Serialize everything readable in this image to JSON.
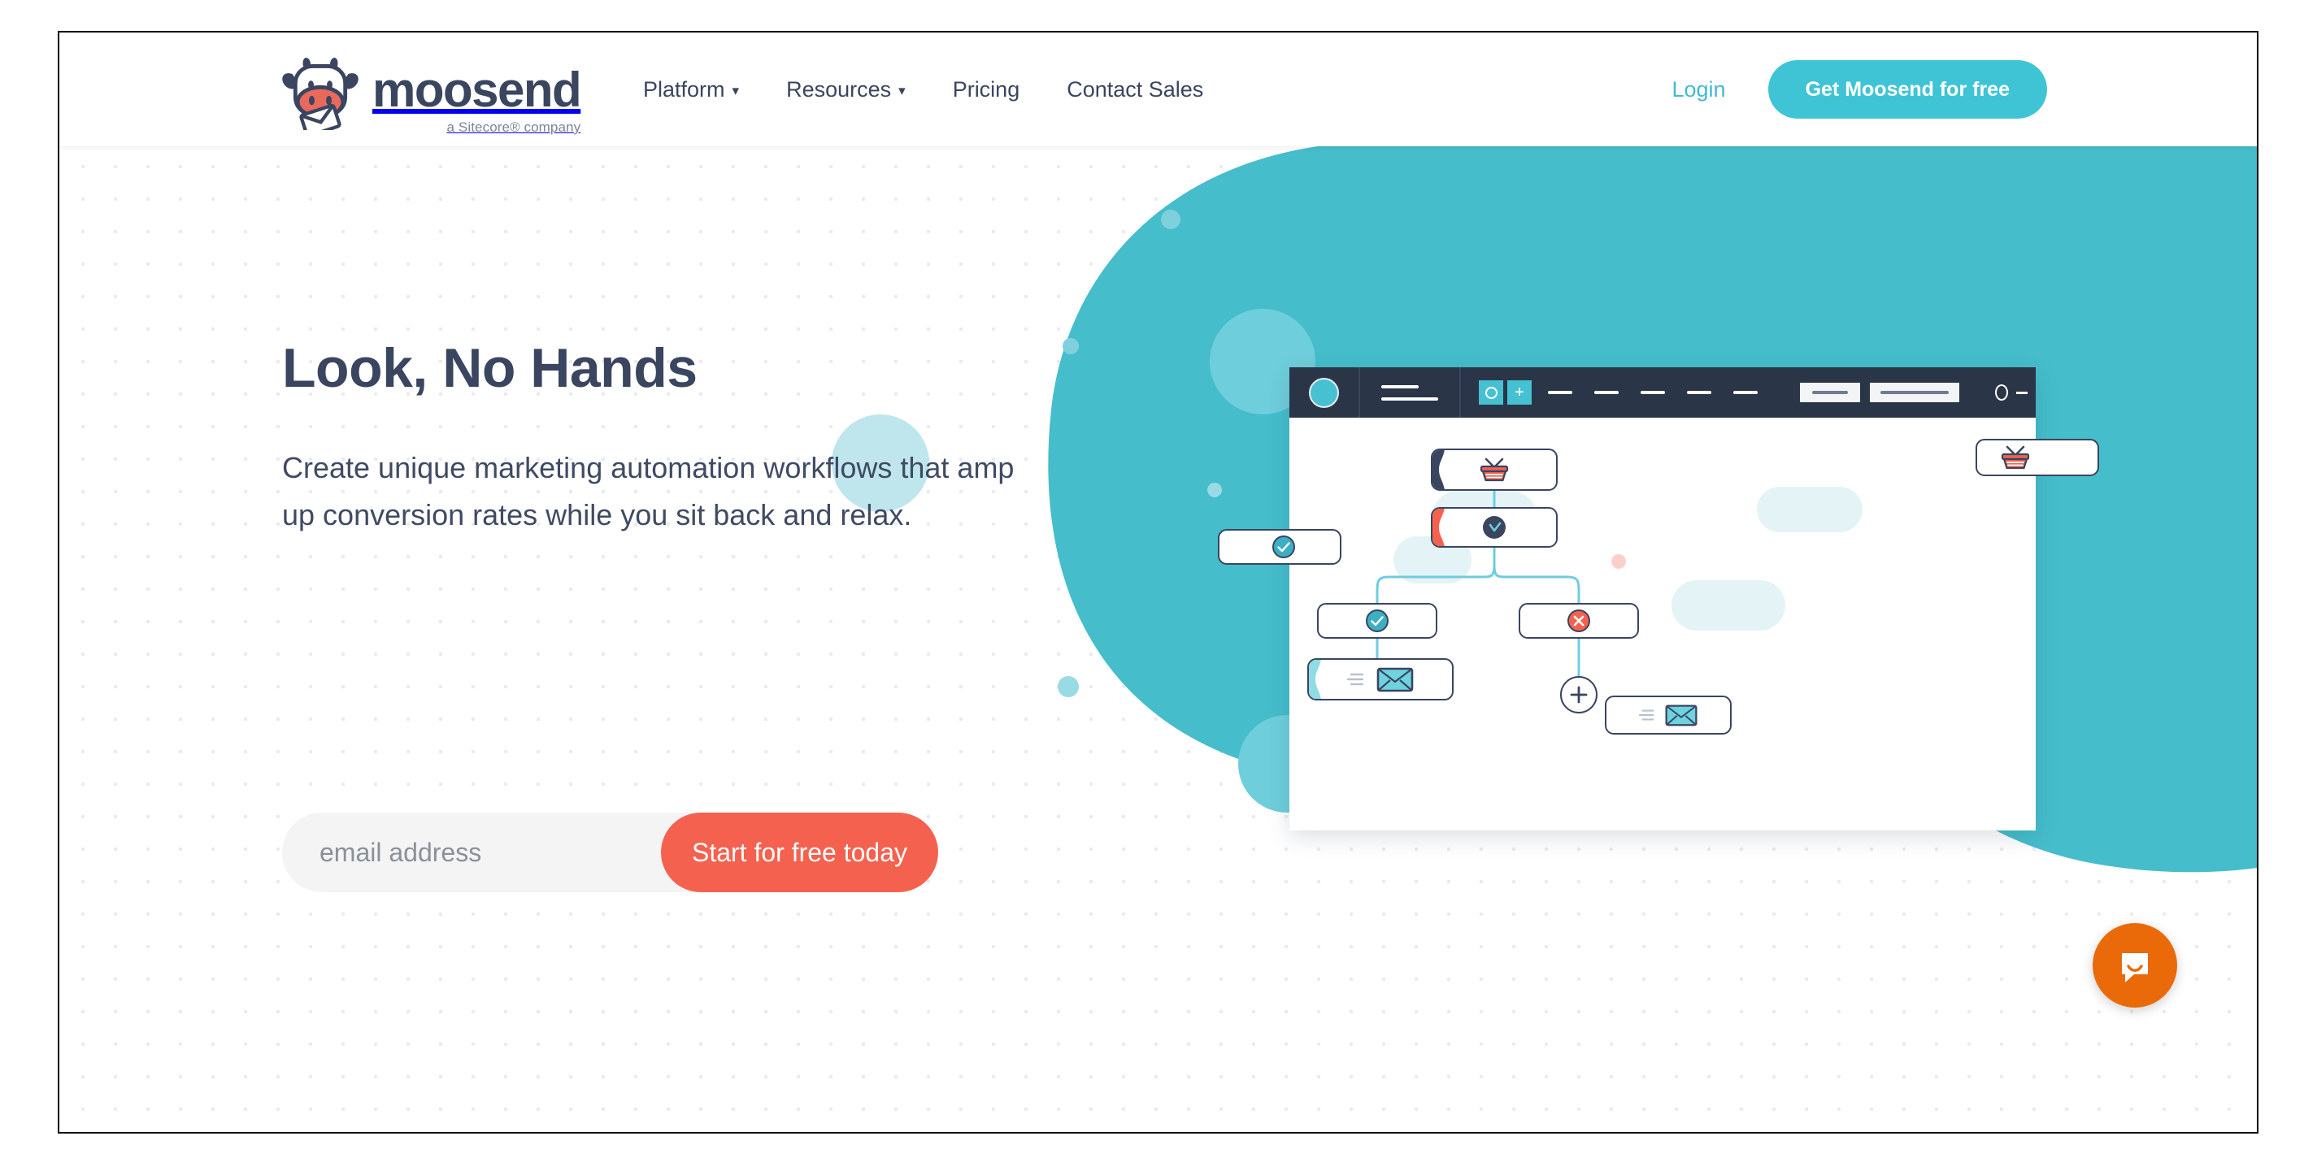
{
  "brand": {
    "wordmark": "moosend",
    "tagline": "a Sitecore® company",
    "logo_icon": "cow-head-envelope-logo",
    "teal": "#3FC4D6",
    "navy": "#3A4560",
    "coral": "#F4624F",
    "orange": "#EA6A09"
  },
  "header": {
    "nav": [
      {
        "label": "Platform",
        "caret": "▾",
        "has_dropdown": true
      },
      {
        "label": "Resources",
        "caret": "▾",
        "has_dropdown": true
      },
      {
        "label": "Pricing",
        "caret": "",
        "has_dropdown": false
      },
      {
        "label": "Contact Sales",
        "caret": "",
        "has_dropdown": false
      }
    ],
    "login_label": "Login",
    "cta_label": "Get Moosend for free"
  },
  "hero": {
    "title": "Look, No Hands",
    "subtitle": "Create unique marketing automation workflows that amp up conversion rates while you sit back and relax.",
    "form": {
      "email_placeholder": "email address",
      "email_value": "",
      "submit_label": "Start for free today"
    }
  },
  "illustration": {
    "window_title_icons": [
      "avatar-circle",
      "menu-lines",
      "select-tool",
      "add-tool",
      "toolbar-dashes",
      "save-pill",
      "publish-pill",
      "minimize-control"
    ],
    "nodes": [
      {
        "id": "trigger-cart",
        "icon": "shopping-basket-icon",
        "bar_color": "#3A4560"
      },
      {
        "id": "delay-clock",
        "icon": "clock-icon",
        "bar_color": "#F4624F"
      },
      {
        "id": "branch-yes",
        "icon": "check-circle-icon",
        "bar_color": "none"
      },
      {
        "id": "branch-no",
        "icon": "cross-circle-icon",
        "bar_color": "none"
      },
      {
        "id": "send-email",
        "icon": "envelope-icon",
        "bar_color": "#7ED4DE"
      },
      {
        "id": "floating-check",
        "icon": "check-circle-icon",
        "bar_color": "none"
      },
      {
        "id": "floating-cart",
        "icon": "shopping-basket-icon",
        "bar_color": "none"
      },
      {
        "id": "floating-email",
        "icon": "envelope-icon",
        "bar_color": "none"
      },
      {
        "id": "add-step",
        "icon": "plus-circle-icon",
        "bar_color": "none"
      }
    ]
  },
  "chat": {
    "icon": "chat-bubble-icon",
    "label": "Open live chat"
  }
}
